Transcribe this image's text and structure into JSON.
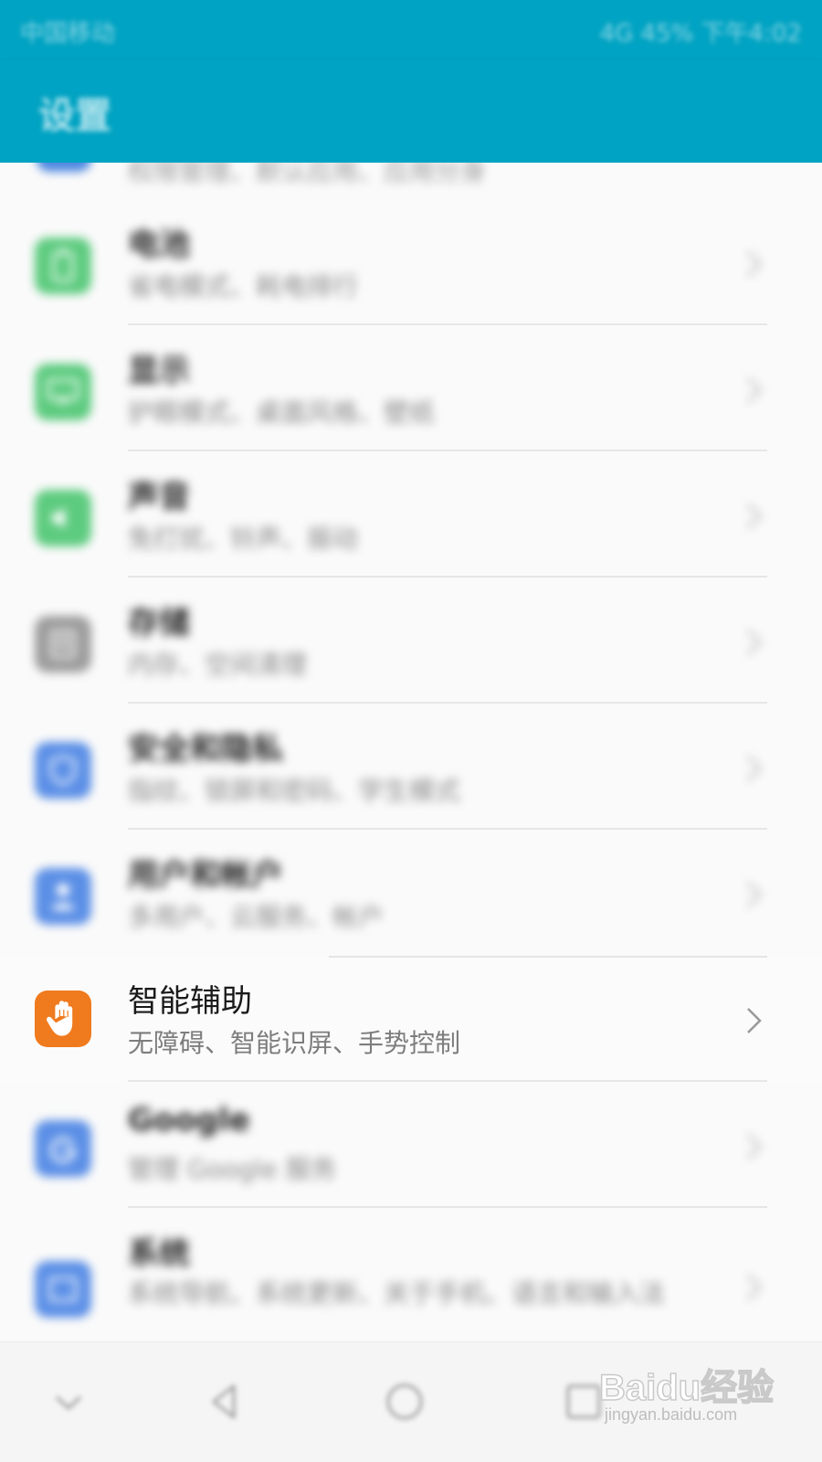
{
  "status_bar": {
    "carrier": "中国移动",
    "right_text": "4G 45% 下午4:02"
  },
  "header": {
    "title": "设置"
  },
  "partial_row": {
    "subtitle": "权限管理、默认应用、应用分身"
  },
  "rows": [
    {
      "title": "电池",
      "subtitle": "省电模式、耗电排行",
      "color": "#5dcb7f",
      "icon": "battery-icon"
    },
    {
      "title": "显示",
      "subtitle": "护眼模式、桌面风格、壁纸",
      "color": "#5dcb7f",
      "icon": "display-icon"
    },
    {
      "title": "声音",
      "subtitle": "免打扰、铃声、振动",
      "color": "#5dcb7f",
      "icon": "sound-icon"
    },
    {
      "title": "存储",
      "subtitle": "内存、空间清理",
      "color": "#9d9d9d",
      "icon": "storage-icon"
    },
    {
      "title": "安全和隐私",
      "subtitle": "指纹、锁屏和密码、学生模式",
      "color": "#5b8fe6",
      "icon": "security-icon"
    },
    {
      "title": "用户和帐户",
      "subtitle": "多用户、云服务、帐户",
      "color": "#5b8fe6",
      "icon": "user-icon"
    },
    {
      "title": "智能辅助",
      "subtitle": "无障碍、智能识屏、手势控制",
      "color": "#f07a1e",
      "icon": "hand-icon"
    },
    {
      "title": "Google",
      "subtitle": "管理 Google 服务",
      "color": "#5b8fe6",
      "icon": "google-icon"
    },
    {
      "title": "系统",
      "subtitle": "系统导航、系统更新、关于手机、语言和输入法",
      "color": "#5b8fe6",
      "icon": "system-icon"
    }
  ],
  "nav_bar": {
    "items": [
      "hide-icon",
      "back-icon",
      "home-icon",
      "recents-icon"
    ]
  },
  "watermark": {
    "logo_text": "Baidu经验",
    "url": "jingyan.baidu.com"
  }
}
